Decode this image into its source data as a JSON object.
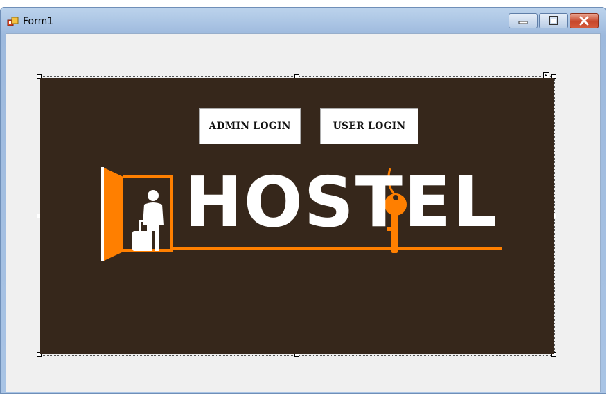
{
  "window": {
    "title": "Form1",
    "controls": {
      "minimize": "minimize-icon",
      "maximize": "maximize-icon",
      "close": "close-icon"
    }
  },
  "banner": {
    "background": "#36271b",
    "accent": "#ff7f00",
    "buttons": {
      "admin_label": "ADMIN LOGIN",
      "user_label": "USER LOGIN"
    },
    "logo_text": "HOSTEL"
  }
}
